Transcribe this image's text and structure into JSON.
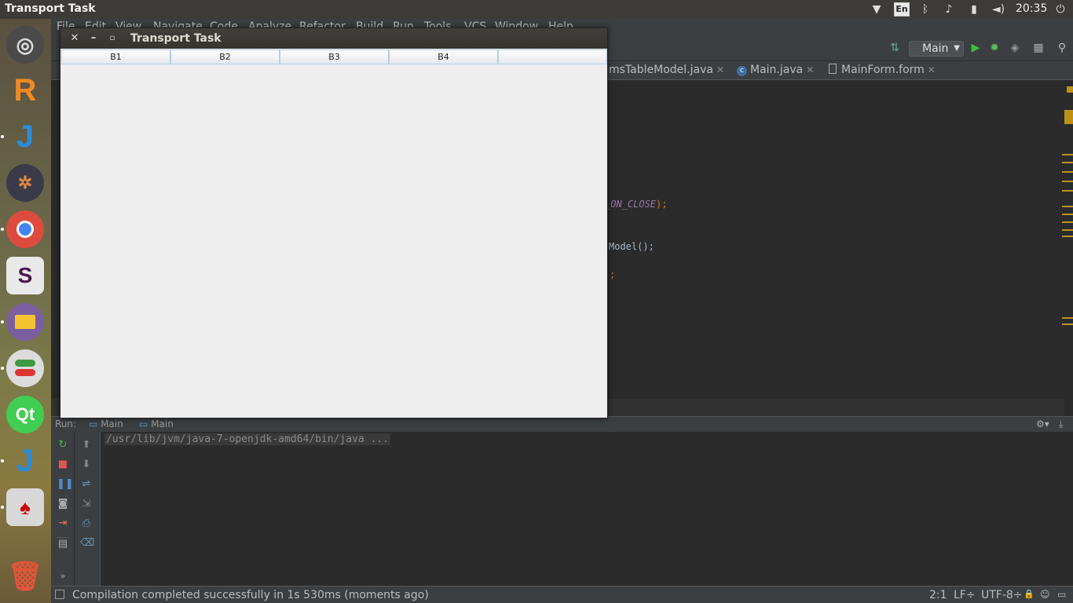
{
  "topbar": {
    "window_title": "Transport Task",
    "keyboard_layout": "En",
    "time": "20:35"
  },
  "launcher": {
    "items": [
      "ubuntu-dash",
      "mysql-workbench",
      "intellij-idea",
      "system-tools",
      "chrome",
      "slack",
      "files",
      "switcher",
      "qt-creator",
      "intellij-idea-2",
      "java-app",
      "trash"
    ]
  },
  "ide": {
    "menu": [
      "File",
      "Edit",
      "View",
      "Navigate",
      "Code",
      "Analyze",
      "Refactor",
      "Build",
      "Run",
      "Tools",
      "VCS",
      "Window",
      "Help"
    ],
    "run_config": "Main",
    "tabs": [
      {
        "label": "msTableModel.java"
      },
      {
        "label": "Main.java"
      },
      {
        "label": "MainForm.form"
      }
    ],
    "code": {
      "line1_const": "_ON_CLOSE",
      "line1_tail": ");",
      "line2": "Model();",
      "line3": ";"
    },
    "run": {
      "label": "Run:",
      "tab1": "Main",
      "tab2": "Main",
      "console_line": "/usr/lib/jvm/java-7-openjdk-amd64/bin/java ..."
    },
    "status": {
      "message": "Compilation completed successfully in 1s 530ms (moments ago)",
      "position": "2:1",
      "line_sep": "LF÷",
      "encoding": "UTF-8÷"
    }
  },
  "swing_window": {
    "title": "Transport Task",
    "columns": [
      "B1",
      "B2",
      "B3",
      "B4",
      ""
    ]
  }
}
